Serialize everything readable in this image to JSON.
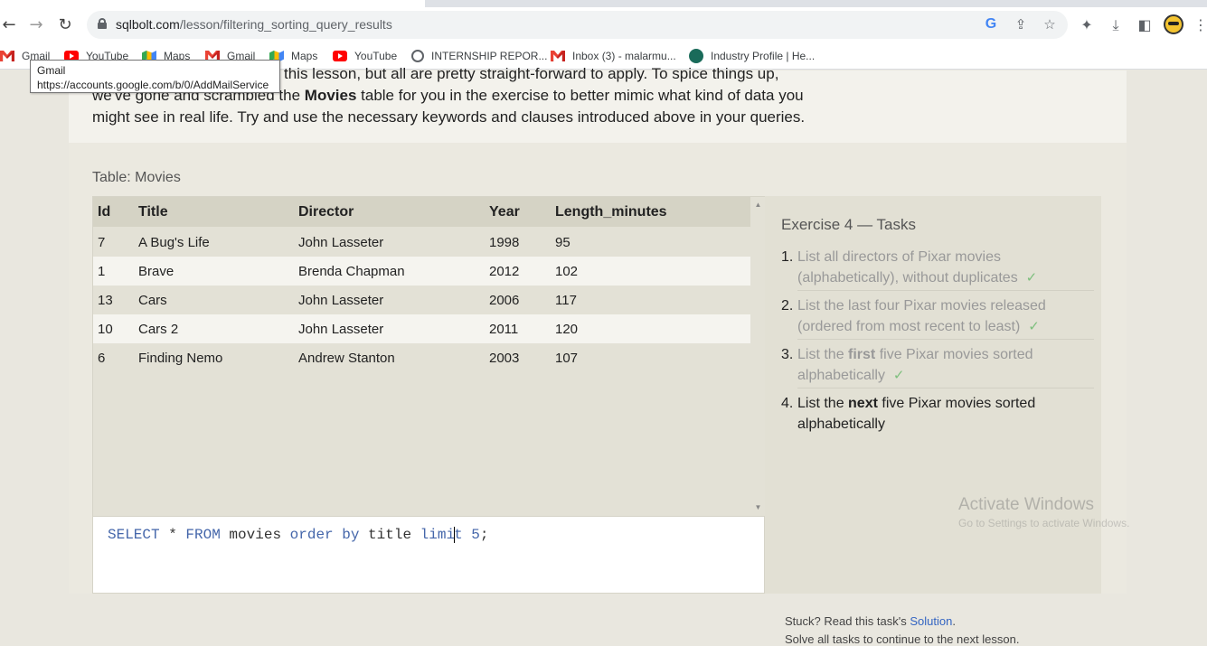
{
  "browser": {
    "url_host": "sqlbolt.com",
    "url_path": "/lesson/filtering_sorting_query_results",
    "bookmarks": [
      {
        "label": "Gmail",
        "icon": "gmail-icon"
      },
      {
        "label": "YouTube",
        "icon": "youtube-icon"
      },
      {
        "label": "Maps",
        "icon": "maps-icon"
      },
      {
        "label": "Gmail",
        "icon": "gmail-icon"
      },
      {
        "label": "Maps",
        "icon": "maps-icon"
      },
      {
        "label": "YouTube",
        "icon": "youtube-icon"
      },
      {
        "label": "INTERNSHIP REPOR...",
        "icon": "globe-icon"
      },
      {
        "label": "Inbox (3) - malarmu...",
        "icon": "gmail-icon"
      },
      {
        "label": "Industry Profile | He...",
        "icon": "site-icon"
      }
    ],
    "tooltip": {
      "title": "Gmail",
      "url": "https://accounts.google.com/b/0/AddMailService"
    }
  },
  "intro": {
    "line1": "this lesson, but all are pretty straight-forward to apply. To spice things up,",
    "line2_prefix": "we've gone and scrambled the ",
    "line2_bold": "Movies",
    "line2_suffix": " table for you in the exercise to better mimic what kind of data you",
    "line3": "might see in real life. Try and use the necessary keywords and clauses introduced above in your queries."
  },
  "table": {
    "caption": "Table: Movies",
    "columns": [
      "Id",
      "Title",
      "Director",
      "Year",
      "Length_minutes"
    ],
    "rows": [
      [
        "7",
        "A Bug's Life",
        "John Lasseter",
        "1998",
        "95"
      ],
      [
        "1",
        "Brave",
        "Brenda Chapman",
        "2012",
        "102"
      ],
      [
        "13",
        "Cars",
        "John Lasseter",
        "2006",
        "117"
      ],
      [
        "10",
        "Cars 2",
        "John Lasseter",
        "2011",
        "120"
      ],
      [
        "6",
        "Finding Nemo",
        "Andrew Stanton",
        "2003",
        "107"
      ]
    ]
  },
  "editor": {
    "query": "SELECT * FROM movies order by title limit 5;"
  },
  "tasks": {
    "title": "Exercise 4 — Tasks",
    "items": [
      {
        "num": "1.",
        "text": "List all directors of Pixar movies (alphabetically), without duplicates",
        "done": true
      },
      {
        "num": "2.",
        "text": "List the last four Pixar movies released (ordered from most recent to least)",
        "done": true
      },
      {
        "num": "3.",
        "pre": "List the ",
        "bold": "first",
        "post": " five Pixar movies sorted alphabetically",
        "done": true
      },
      {
        "num": "4.",
        "pre": "List the ",
        "bold": "next",
        "post": " five Pixar movies sorted alphabetically",
        "done": false
      }
    ],
    "stuck_prefix": "Stuck? Read this task's ",
    "stuck_link": "Solution",
    "stuck_suffix": ".",
    "solve_text": "Solve all tasks to continue to the next lesson."
  },
  "watermark": {
    "line1": "Activate Windows",
    "line2": "Go to Settings to activate Windows."
  },
  "colors": {
    "accent_link": "#3465c2",
    "check": "#7dbf7d",
    "keyword": "#4466aa"
  }
}
